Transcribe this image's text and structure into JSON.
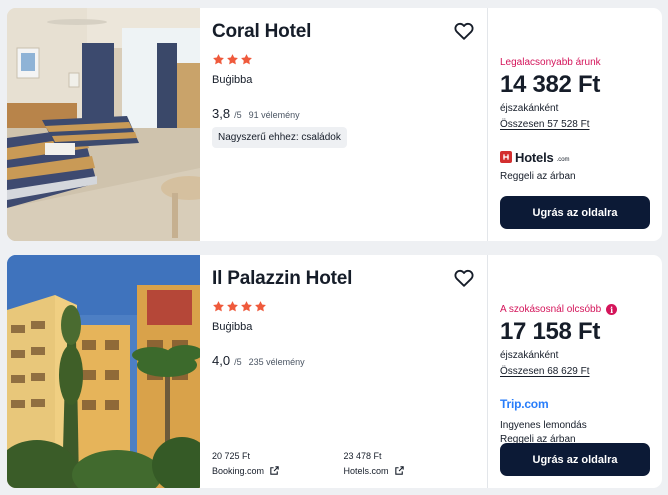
{
  "colors": {
    "page_bg": "#eef0f3",
    "star": "#ef5a3c",
    "badge": "#d4145a",
    "cta_bg": "#0c1a36",
    "trip_blue": "#287dfa",
    "hotels_red": "#d32f2f"
  },
  "results": [
    {
      "name": "Coral Hotel",
      "stars": 3,
      "location": "Buġibba",
      "score": "3,8",
      "score_max": "/5",
      "reviews": "91 vélemény",
      "tag": "Nagyszerű ehhez: családok",
      "favorite_icon": "heart-outline-icon",
      "offer": {
        "badge": "Legalacsonyabb árunk",
        "price": "14 382 Ft",
        "per_night": "éjszakánként",
        "total": "Összesen 57 528 Ft",
        "provider": "Hotels",
        "provider_suffix": ".com",
        "features": [
          "Reggeli az árban"
        ],
        "cta": "Ugrás az oldalra"
      }
    },
    {
      "name": "Il Palazzin Hotel",
      "stars": 4,
      "location": "Buġibba",
      "score": "4,0",
      "score_max": "/5",
      "reviews": "235 vélemény",
      "favorite_icon": "heart-outline-icon",
      "alt_prices": [
        {
          "amount": "20 725 Ft",
          "provider": "Booking.com"
        },
        {
          "amount": "23 478 Ft",
          "provider": "Hotels.com"
        }
      ],
      "offer": {
        "badge": "A szokásosnál olcsóbb",
        "badge_icon": "i",
        "price": "17 158 Ft",
        "per_night": "éjszakánként",
        "total": "Összesen 68 629 Ft",
        "provider": "Trip.com",
        "features": [
          "Ingyenes lemondás",
          "Reggeli az árban"
        ],
        "cta": "Ugrás az oldalra"
      }
    }
  ]
}
